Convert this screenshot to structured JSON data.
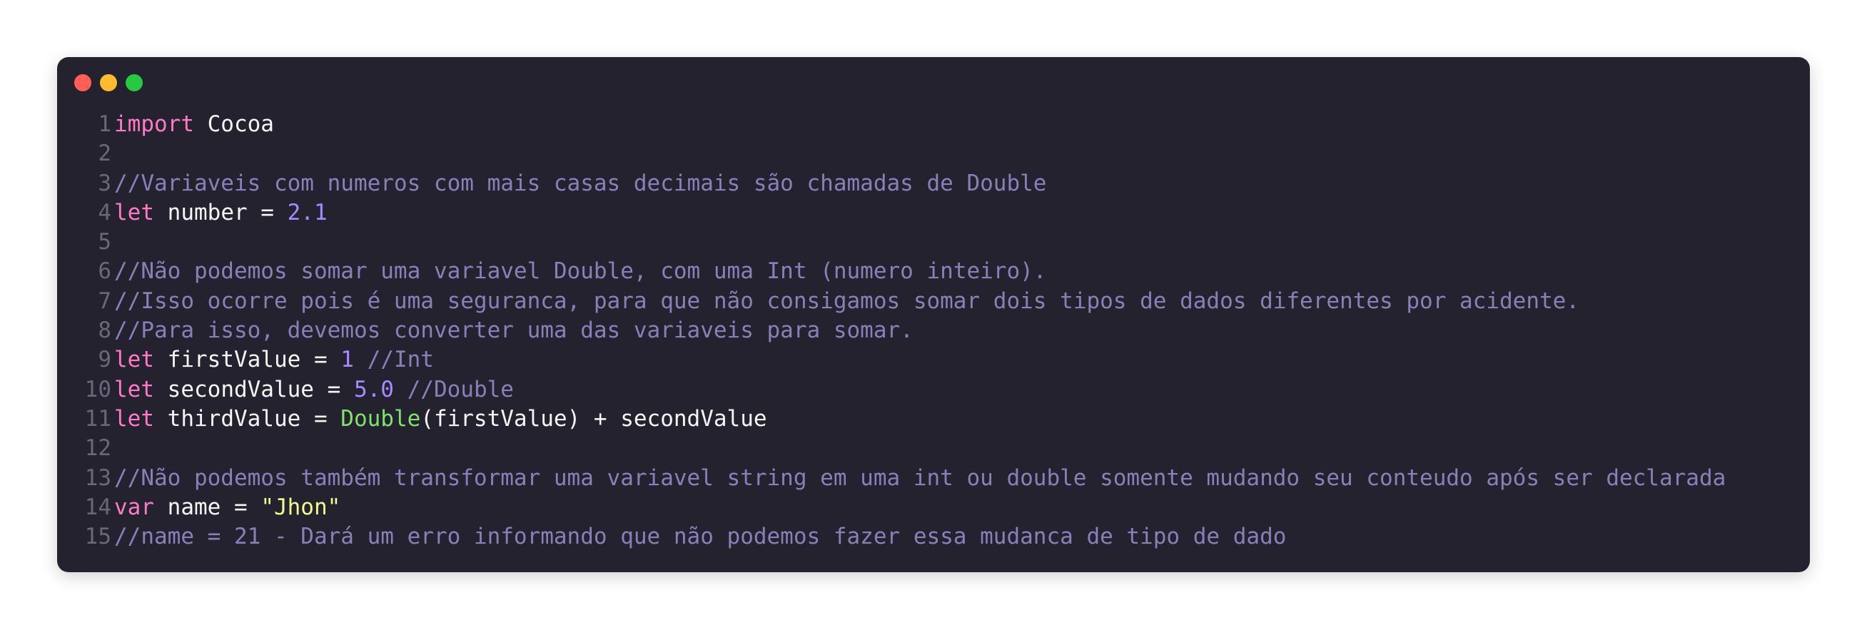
{
  "window": {
    "controls": [
      {
        "name": "close",
        "color": "#ff5f57"
      },
      {
        "name": "minimize",
        "color": "#febc2e"
      },
      {
        "name": "maximize",
        "color": "#28c840"
      }
    ]
  },
  "colors": {
    "background": "#24222f",
    "keyword": "#ff79c6",
    "number": "#a48cff",
    "string": "#f1fa8c",
    "comment": "#8a80b8",
    "type": "#7fe36a",
    "text": "#f5f5f5",
    "line_number": "#6a6878"
  },
  "code": {
    "lines": [
      {
        "n": "1",
        "tokens": [
          {
            "t": "kw",
            "v": "import"
          },
          {
            "t": "plain",
            "v": " Cocoa"
          }
        ]
      },
      {
        "n": "2",
        "tokens": []
      },
      {
        "n": "3",
        "tokens": [
          {
            "t": "cm",
            "v": "//Variaveis com numeros com mais casas decimais são chamadas de Double"
          }
        ]
      },
      {
        "n": "4",
        "tokens": [
          {
            "t": "kw",
            "v": "let"
          },
          {
            "t": "plain",
            "v": " number = "
          },
          {
            "t": "num",
            "v": "2.1"
          }
        ]
      },
      {
        "n": "5",
        "tokens": []
      },
      {
        "n": "6",
        "tokens": [
          {
            "t": "cm",
            "v": "//Não podemos somar uma variavel Double, com uma Int (numero inteiro)."
          }
        ]
      },
      {
        "n": "7",
        "tokens": [
          {
            "t": "cm",
            "v": "//Isso ocorre pois é uma seguranca, para que não consigamos somar dois tipos de dados diferentes por acidente."
          }
        ]
      },
      {
        "n": "8",
        "tokens": [
          {
            "t": "cm",
            "v": "//Para isso, devemos converter uma das variaveis para somar."
          }
        ]
      },
      {
        "n": "9",
        "tokens": [
          {
            "t": "kw",
            "v": "let"
          },
          {
            "t": "plain",
            "v": " firstValue = "
          },
          {
            "t": "num",
            "v": "1"
          },
          {
            "t": "cm",
            "v": " //Int"
          }
        ]
      },
      {
        "n": "10",
        "tokens": [
          {
            "t": "kw",
            "v": "let"
          },
          {
            "t": "plain",
            "v": " secondValue = "
          },
          {
            "t": "num",
            "v": "5.0"
          },
          {
            "t": "cm",
            "v": " //Double"
          }
        ]
      },
      {
        "n": "11",
        "tokens": [
          {
            "t": "kw",
            "v": "let"
          },
          {
            "t": "plain",
            "v": " thirdValue = "
          },
          {
            "t": "ty",
            "v": "Double"
          },
          {
            "t": "plain",
            "v": "(firstValue) + secondValue"
          }
        ]
      },
      {
        "n": "12",
        "tokens": []
      },
      {
        "n": "13",
        "tokens": [
          {
            "t": "cm",
            "v": "//Não podemos também transformar uma variavel string em uma int ou double somente mudando seu conteudo após ser declarada"
          }
        ]
      },
      {
        "n": "14",
        "tokens": [
          {
            "t": "kw",
            "v": "var"
          },
          {
            "t": "plain",
            "v": " name = "
          },
          {
            "t": "str",
            "v": "\"Jhon\""
          }
        ]
      },
      {
        "n": "15",
        "tokens": [
          {
            "t": "cm",
            "v": "//name = 21 - Dará um erro informando que não podemos fazer essa mudanca de tipo de dado"
          }
        ]
      }
    ]
  }
}
